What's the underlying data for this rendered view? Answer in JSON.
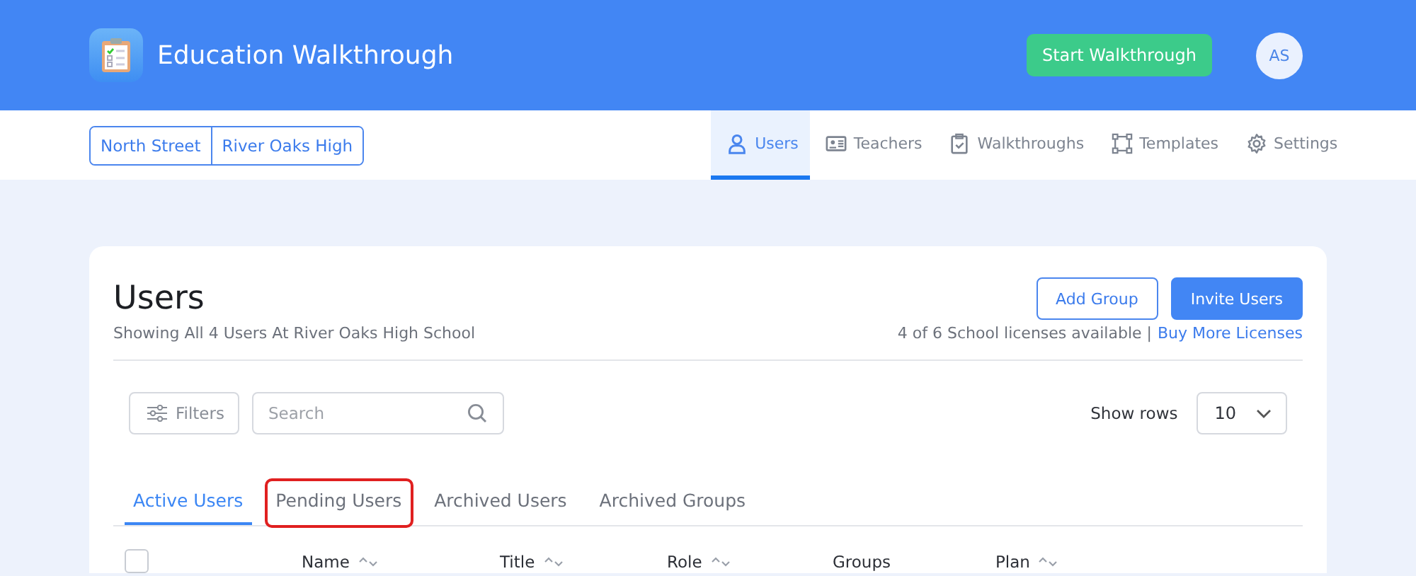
{
  "header": {
    "app_title": "Education Walkthrough",
    "start_button": "Start Walkthrough",
    "avatar_initials": "AS"
  },
  "schools": [
    {
      "label": "North Street",
      "selected": false
    },
    {
      "label": "River Oaks High",
      "selected": false
    }
  ],
  "nav": [
    {
      "label": "Users",
      "kind": "user",
      "selected": true
    },
    {
      "label": "Teachers",
      "kind": "idcard",
      "selected": false
    },
    {
      "label": "Walkthroughs",
      "kind": "clipboard",
      "selected": false
    },
    {
      "label": "Templates",
      "kind": "nodes",
      "selected": false
    },
    {
      "label": "Settings",
      "kind": "gear",
      "selected": false
    }
  ],
  "panel": {
    "title": "Users",
    "subtitle": "Showing All 4 Users At River Oaks High School",
    "add_group": "Add Group",
    "invite": "Invite Users",
    "licenses": "4 of 6 School licenses available |",
    "buy_link": "Buy More Licenses",
    "filters": "Filters",
    "search_placeholder": "Search",
    "show_rows_label": "Show rows",
    "rows_value": "10",
    "tabs": [
      {
        "label": "Active Users",
        "selected": true,
        "highlighted": false
      },
      {
        "label": "Pending Users",
        "selected": false,
        "highlighted": true
      },
      {
        "label": "Archived Users",
        "selected": false,
        "highlighted": false
      },
      {
        "label": "Archived Groups",
        "selected": false,
        "highlighted": false
      }
    ],
    "select_all_checked": false,
    "columns": [
      {
        "label": "Name",
        "sortable": true
      },
      {
        "label": "Title",
        "sortable": true
      },
      {
        "label": "Role",
        "sortable": true
      },
      {
        "label": "Groups",
        "sortable": false
      },
      {
        "label": "Plan",
        "sortable": true
      }
    ]
  }
}
